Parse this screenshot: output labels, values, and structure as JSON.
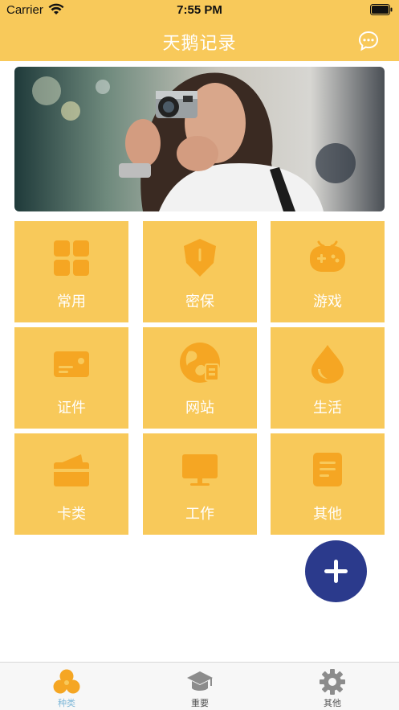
{
  "status_bar": {
    "carrier": "Carrier",
    "time": "7:55 PM"
  },
  "nav": {
    "title": "天鹅记录",
    "right_icon": "chat-bubble-icon"
  },
  "banner": {
    "description_icon": "photo-banner"
  },
  "categories": [
    {
      "label": "常用",
      "icon": "grid-icon"
    },
    {
      "label": "密保",
      "icon": "shield-icon"
    },
    {
      "label": "游戏",
      "icon": "gamepad-icon"
    },
    {
      "label": "证件",
      "icon": "id-card-icon"
    },
    {
      "label": "网站",
      "icon": "globe-icon"
    },
    {
      "label": "生活",
      "icon": "water-drop-icon"
    },
    {
      "label": "卡类",
      "icon": "wallet-card-icon"
    },
    {
      "label": "工作",
      "icon": "monitor-icon"
    },
    {
      "label": "其他",
      "icon": "document-icon"
    }
  ],
  "fab": {
    "icon": "plus-icon"
  },
  "tabs": [
    {
      "label": "种类",
      "icon": "categories-icon",
      "active": true
    },
    {
      "label": "重要",
      "icon": "graduation-cap-icon",
      "active": false
    },
    {
      "label": "其他",
      "icon": "gear-icon",
      "active": false
    }
  ],
  "colors": {
    "accent": "#f8c95a",
    "icon_orange": "#f5a623",
    "fab": "#2b3a8c",
    "tab_active": "#7fb8d8",
    "tab_inactive": "#555555",
    "tab_icon_inactive": "#8c8c8c"
  }
}
